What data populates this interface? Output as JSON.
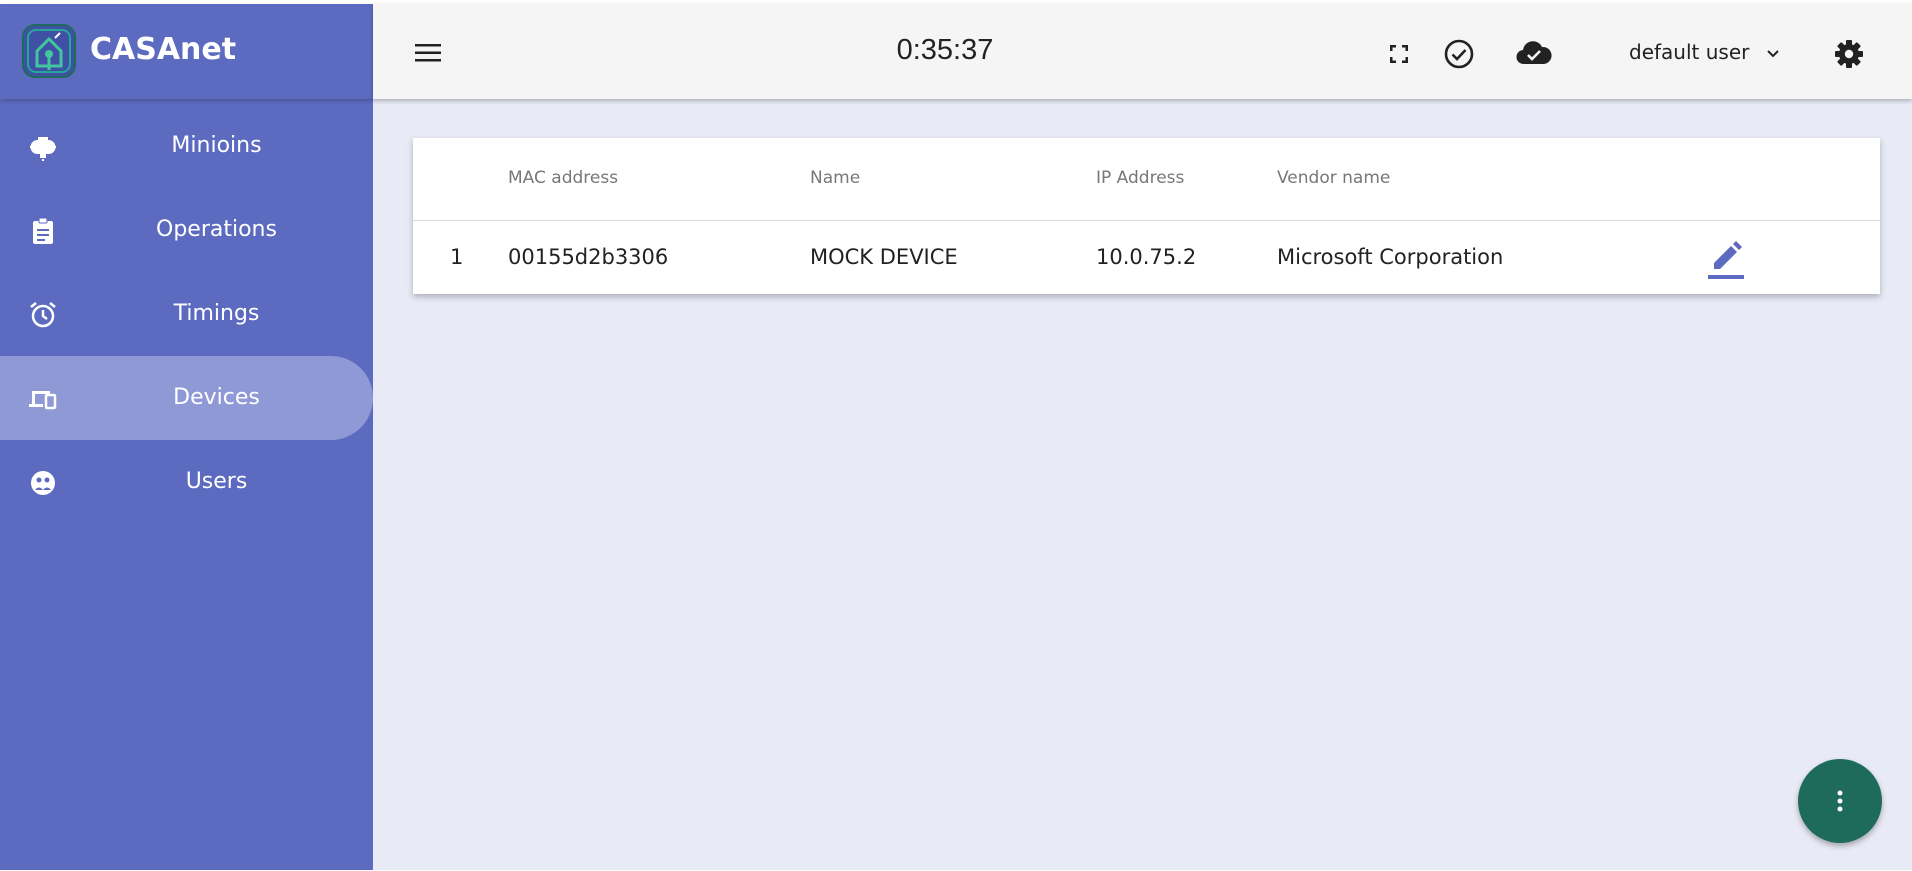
{
  "brand": {
    "name": "CASAnet",
    "accent": "#5c6bc0"
  },
  "sidebar": {
    "items": [
      {
        "label": "Minioins",
        "icon": "lightbulb-icon",
        "active": false
      },
      {
        "label": "Operations",
        "icon": "clipboard-icon",
        "active": false
      },
      {
        "label": "Timings",
        "icon": "alarm-clock-icon",
        "active": false
      },
      {
        "label": "Devices",
        "icon": "devices-icon",
        "active": true
      },
      {
        "label": "Users",
        "icon": "users-icon",
        "active": false
      }
    ]
  },
  "header": {
    "clock": "0:35:37",
    "icons": [
      "fullscreen-icon",
      "check-circle-icon",
      "cloud-done-icon",
      "settings-gear-icon"
    ],
    "user": "default user"
  },
  "table": {
    "columns": [
      "",
      "MAC address",
      "Name",
      "IP Address",
      "Vendor name",
      ""
    ],
    "rows": [
      {
        "index": "1",
        "mac": "00155d2b3306",
        "name": "MOCK DEVICE",
        "ip": "10.0.75.2",
        "vendor": "Microsoft Corporation"
      }
    ]
  },
  "colors": {
    "sidebar": "#5c6bc0",
    "sidebar_active": "#8e99d6",
    "background": "#e8eaf6",
    "fab": "#1e6b5c",
    "edit_icon": "#5c6bc0"
  }
}
